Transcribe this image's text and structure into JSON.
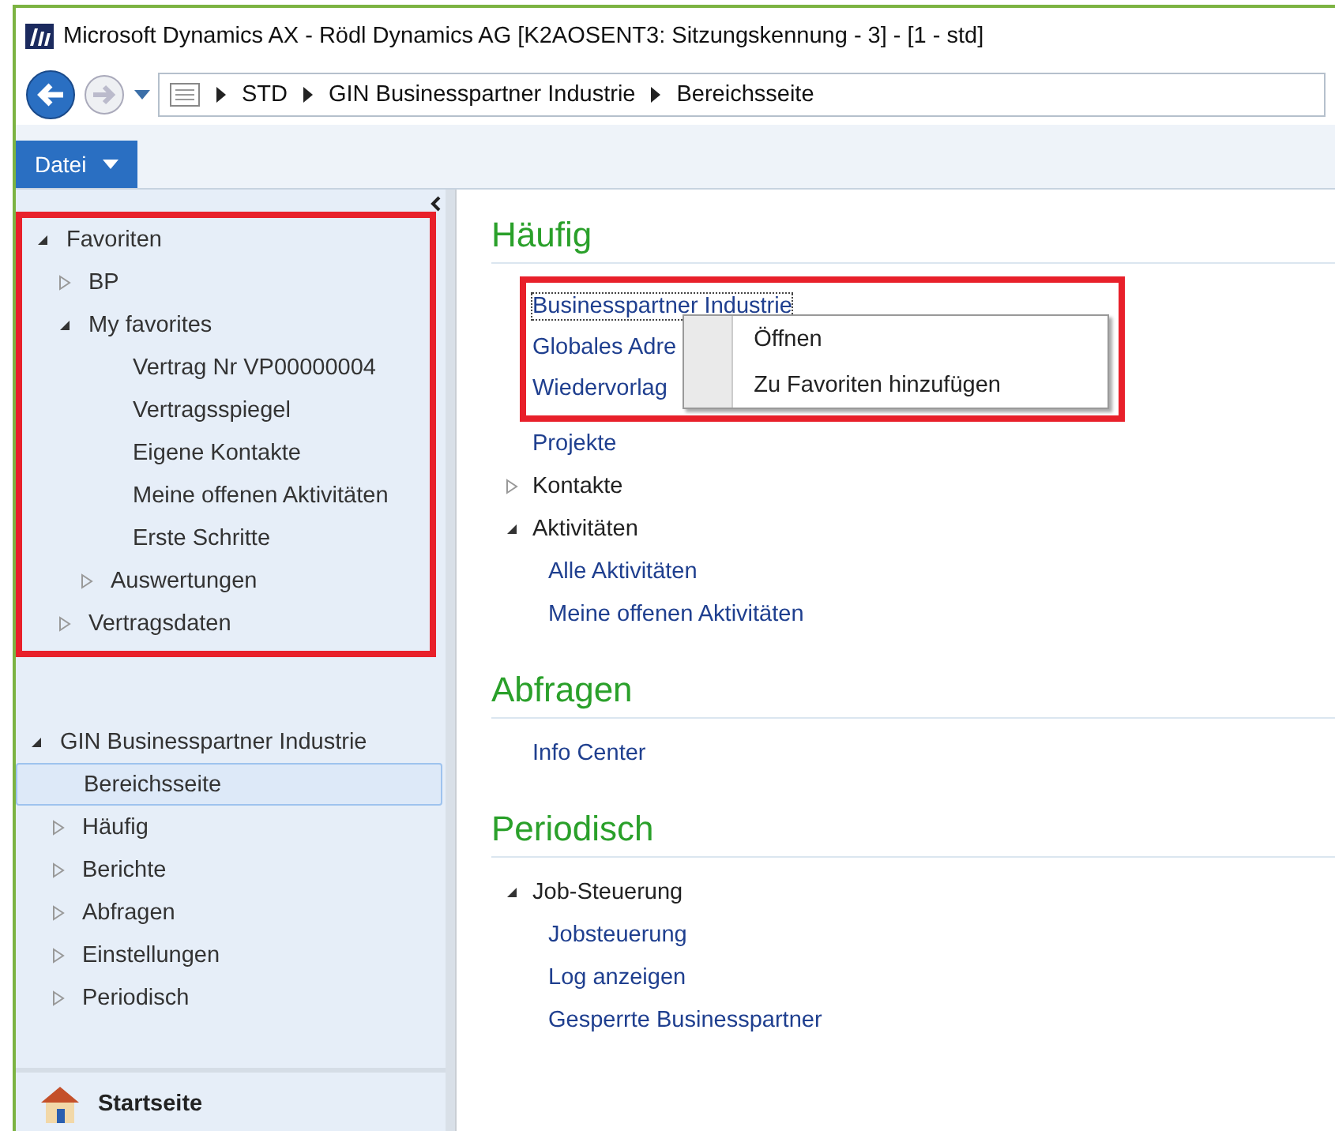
{
  "window": {
    "title": "Microsoft Dynamics AX - Rödl Dynamics AG [K2AOSENT3: Sitzungskennung - 3] -  [1 - std]"
  },
  "address_bar": {
    "breadcrumb": [
      "STD",
      "GIN Businesspartner Industrie",
      "Bereichsseite"
    ]
  },
  "ribbon": {
    "file_tab": "Datei"
  },
  "favorites": {
    "label": "Favoriten",
    "expanded": true,
    "children": [
      {
        "label": "BP",
        "expanded": false
      },
      {
        "label": "My favorites",
        "expanded": true,
        "children": [
          {
            "label": "Vertrag Nr VP00000004"
          },
          {
            "label": "Vertragsspiegel"
          },
          {
            "label": "Eigene Kontakte"
          },
          {
            "label": "Meine offenen Aktivitäten"
          },
          {
            "label": "Erste Schritte"
          },
          {
            "label": "Auswertungen",
            "expanded": false
          }
        ]
      },
      {
        "label": "Vertragsdaten",
        "expanded": false
      }
    ]
  },
  "navigation": {
    "label": "GIN Businesspartner Industrie",
    "expanded": true,
    "children": [
      {
        "label": "Bereichsseite",
        "selected": true
      },
      {
        "label": "Häufig",
        "expanded": false,
        "selected": false
      },
      {
        "label": "Berichte",
        "expanded": false,
        "selected": false
      },
      {
        "label": "Abfragen",
        "expanded": false,
        "selected": false
      },
      {
        "label": "Einstellungen",
        "expanded": false,
        "selected": false
      },
      {
        "label": "Periodisch",
        "expanded": false,
        "selected": false
      }
    ]
  },
  "home_button": "Startseite",
  "sections": [
    {
      "title": "Häufig",
      "highlighted_links": [
        {
          "label": "Businesspartner Industrie",
          "focused": true
        },
        {
          "label": "Globales Adre",
          "focused": false
        },
        {
          "label": "Wiedervorlag",
          "focused": false
        }
      ],
      "context_menu": {
        "items": [
          "Öffnen",
          "Zu Favoriten hinzufügen"
        ]
      },
      "items": [
        {
          "kind": "link",
          "label": "Projekte"
        },
        {
          "kind": "group",
          "label": "Kontakte",
          "expanded": false
        },
        {
          "kind": "group",
          "label": "Aktivitäten",
          "expanded": true,
          "children": [
            {
              "label": "Alle Aktivitäten"
            },
            {
              "label": "Meine offenen Aktivitäten"
            }
          ]
        }
      ]
    },
    {
      "title": "Abfragen",
      "items": [
        {
          "kind": "link",
          "label": "Info Center"
        }
      ]
    },
    {
      "title": "Periodisch",
      "items": [
        {
          "kind": "group",
          "label": "Job-Steuerung",
          "expanded": true,
          "children": [
            {
              "label": "Jobsteuerung"
            },
            {
              "label": "Log anzeigen"
            },
            {
              "label": "Gesperrte Businesspartner"
            }
          ]
        }
      ]
    }
  ]
}
